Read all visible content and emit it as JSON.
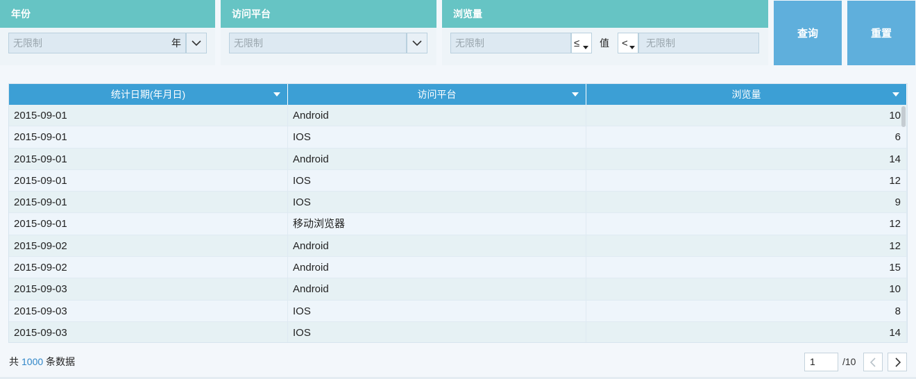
{
  "filters": {
    "year": {
      "label": "年份",
      "placeholder": "无限制",
      "suffix": "年"
    },
    "platform": {
      "label": "访问平台",
      "placeholder": "无限制"
    },
    "views": {
      "label": "浏览量",
      "from_placeholder": "无限制",
      "from_op": "≤",
      "value_label": "值",
      "to_op": "<",
      "to_placeholder": "无限制"
    }
  },
  "actions": {
    "query": "查询",
    "reset": "重置"
  },
  "table": {
    "columns": [
      "统计日期(年月日)",
      "访问平台",
      "浏览量"
    ],
    "rows": [
      [
        "2015-09-01",
        "Android",
        "10"
      ],
      [
        "2015-09-01",
        "IOS",
        "6"
      ],
      [
        "2015-09-01",
        "Android",
        "14"
      ],
      [
        "2015-09-01",
        "IOS",
        "12"
      ],
      [
        "2015-09-01",
        "IOS",
        "9"
      ],
      [
        "2015-09-01",
        "移动浏览器",
        "12"
      ],
      [
        "2015-09-02",
        "Android",
        "12"
      ],
      [
        "2015-09-02",
        "Android",
        "15"
      ],
      [
        "2015-09-03",
        "Android",
        "10"
      ],
      [
        "2015-09-03",
        "IOS",
        "8"
      ],
      [
        "2015-09-03",
        "IOS",
        "14"
      ]
    ]
  },
  "footer": {
    "total_prefix": "共",
    "total_count": "1000",
    "total_suffix": "条数据",
    "current_page": "1",
    "page_total": "/10"
  },
  "icons": {
    "dropdown": "chevron-down-icon",
    "prev": "chevron-left-icon",
    "next": "chevron-right-icon",
    "sort": "sort-caret-icon"
  },
  "colors": {
    "panel_header": "#66c4c4",
    "table_header": "#3c9fd5",
    "button": "#5fafdc",
    "link_number": "#2f86c8"
  }
}
